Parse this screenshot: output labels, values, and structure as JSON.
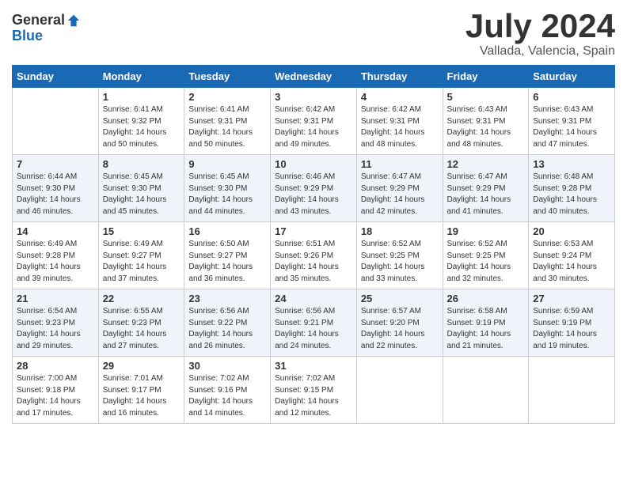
{
  "logo": {
    "general": "General",
    "blue": "Blue"
  },
  "title": {
    "month": "July 2024",
    "location": "Vallada, Valencia, Spain"
  },
  "weekdays": [
    "Sunday",
    "Monday",
    "Tuesday",
    "Wednesday",
    "Thursday",
    "Friday",
    "Saturday"
  ],
  "weeks": [
    [
      {
        "day": "",
        "info": ""
      },
      {
        "day": "1",
        "info": "Sunrise: 6:41 AM\nSunset: 9:32 PM\nDaylight: 14 hours\nand 50 minutes."
      },
      {
        "day": "2",
        "info": "Sunrise: 6:41 AM\nSunset: 9:31 PM\nDaylight: 14 hours\nand 50 minutes."
      },
      {
        "day": "3",
        "info": "Sunrise: 6:42 AM\nSunset: 9:31 PM\nDaylight: 14 hours\nand 49 minutes."
      },
      {
        "day": "4",
        "info": "Sunrise: 6:42 AM\nSunset: 9:31 PM\nDaylight: 14 hours\nand 48 minutes."
      },
      {
        "day": "5",
        "info": "Sunrise: 6:43 AM\nSunset: 9:31 PM\nDaylight: 14 hours\nand 48 minutes."
      },
      {
        "day": "6",
        "info": "Sunrise: 6:43 AM\nSunset: 9:31 PM\nDaylight: 14 hours\nand 47 minutes."
      }
    ],
    [
      {
        "day": "7",
        "info": "Sunrise: 6:44 AM\nSunset: 9:30 PM\nDaylight: 14 hours\nand 46 minutes."
      },
      {
        "day": "8",
        "info": "Sunrise: 6:45 AM\nSunset: 9:30 PM\nDaylight: 14 hours\nand 45 minutes."
      },
      {
        "day": "9",
        "info": "Sunrise: 6:45 AM\nSunset: 9:30 PM\nDaylight: 14 hours\nand 44 minutes."
      },
      {
        "day": "10",
        "info": "Sunrise: 6:46 AM\nSunset: 9:29 PM\nDaylight: 14 hours\nand 43 minutes."
      },
      {
        "day": "11",
        "info": "Sunrise: 6:47 AM\nSunset: 9:29 PM\nDaylight: 14 hours\nand 42 minutes."
      },
      {
        "day": "12",
        "info": "Sunrise: 6:47 AM\nSunset: 9:29 PM\nDaylight: 14 hours\nand 41 minutes."
      },
      {
        "day": "13",
        "info": "Sunrise: 6:48 AM\nSunset: 9:28 PM\nDaylight: 14 hours\nand 40 minutes."
      }
    ],
    [
      {
        "day": "14",
        "info": "Sunrise: 6:49 AM\nSunset: 9:28 PM\nDaylight: 14 hours\nand 39 minutes."
      },
      {
        "day": "15",
        "info": "Sunrise: 6:49 AM\nSunset: 9:27 PM\nDaylight: 14 hours\nand 37 minutes."
      },
      {
        "day": "16",
        "info": "Sunrise: 6:50 AM\nSunset: 9:27 PM\nDaylight: 14 hours\nand 36 minutes."
      },
      {
        "day": "17",
        "info": "Sunrise: 6:51 AM\nSunset: 9:26 PM\nDaylight: 14 hours\nand 35 minutes."
      },
      {
        "day": "18",
        "info": "Sunrise: 6:52 AM\nSunset: 9:25 PM\nDaylight: 14 hours\nand 33 minutes."
      },
      {
        "day": "19",
        "info": "Sunrise: 6:52 AM\nSunset: 9:25 PM\nDaylight: 14 hours\nand 32 minutes."
      },
      {
        "day": "20",
        "info": "Sunrise: 6:53 AM\nSunset: 9:24 PM\nDaylight: 14 hours\nand 30 minutes."
      }
    ],
    [
      {
        "day": "21",
        "info": "Sunrise: 6:54 AM\nSunset: 9:23 PM\nDaylight: 14 hours\nand 29 minutes."
      },
      {
        "day": "22",
        "info": "Sunrise: 6:55 AM\nSunset: 9:23 PM\nDaylight: 14 hours\nand 27 minutes."
      },
      {
        "day": "23",
        "info": "Sunrise: 6:56 AM\nSunset: 9:22 PM\nDaylight: 14 hours\nand 26 minutes."
      },
      {
        "day": "24",
        "info": "Sunrise: 6:56 AM\nSunset: 9:21 PM\nDaylight: 14 hours\nand 24 minutes."
      },
      {
        "day": "25",
        "info": "Sunrise: 6:57 AM\nSunset: 9:20 PM\nDaylight: 14 hours\nand 22 minutes."
      },
      {
        "day": "26",
        "info": "Sunrise: 6:58 AM\nSunset: 9:19 PM\nDaylight: 14 hours\nand 21 minutes."
      },
      {
        "day": "27",
        "info": "Sunrise: 6:59 AM\nSunset: 9:19 PM\nDaylight: 14 hours\nand 19 minutes."
      }
    ],
    [
      {
        "day": "28",
        "info": "Sunrise: 7:00 AM\nSunset: 9:18 PM\nDaylight: 14 hours\nand 17 minutes."
      },
      {
        "day": "29",
        "info": "Sunrise: 7:01 AM\nSunset: 9:17 PM\nDaylight: 14 hours\nand 16 minutes."
      },
      {
        "day": "30",
        "info": "Sunrise: 7:02 AM\nSunset: 9:16 PM\nDaylight: 14 hours\nand 14 minutes."
      },
      {
        "day": "31",
        "info": "Sunrise: 7:02 AM\nSunset: 9:15 PM\nDaylight: 14 hours\nand 12 minutes."
      },
      {
        "day": "",
        "info": ""
      },
      {
        "day": "",
        "info": ""
      },
      {
        "day": "",
        "info": ""
      }
    ]
  ]
}
